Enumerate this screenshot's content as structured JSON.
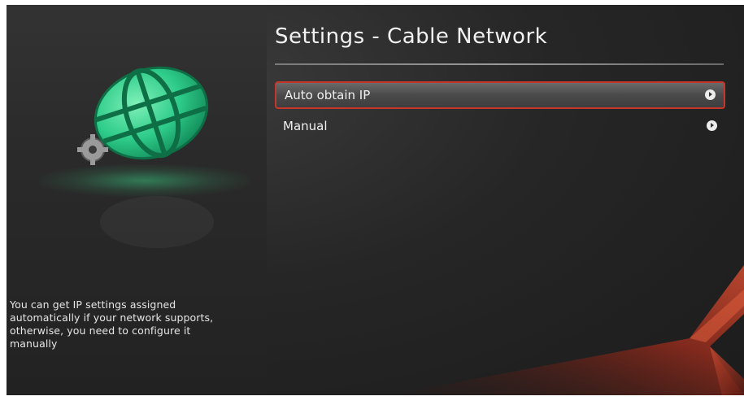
{
  "header": {
    "title": "Settings - Cable Network"
  },
  "menu": {
    "items": [
      {
        "label": "Auto obtain IP",
        "selected": true
      },
      {
        "label": "Manual",
        "selected": false
      }
    ]
  },
  "sidebar": {
    "icon": "network-globe-icon",
    "description": "You can get IP settings assigned automatically if your network supports, otherwise, you need to configure it manually"
  },
  "colors": {
    "accent": "#c8362a",
    "globe": "#2ecc8a",
    "background": "#262626"
  }
}
